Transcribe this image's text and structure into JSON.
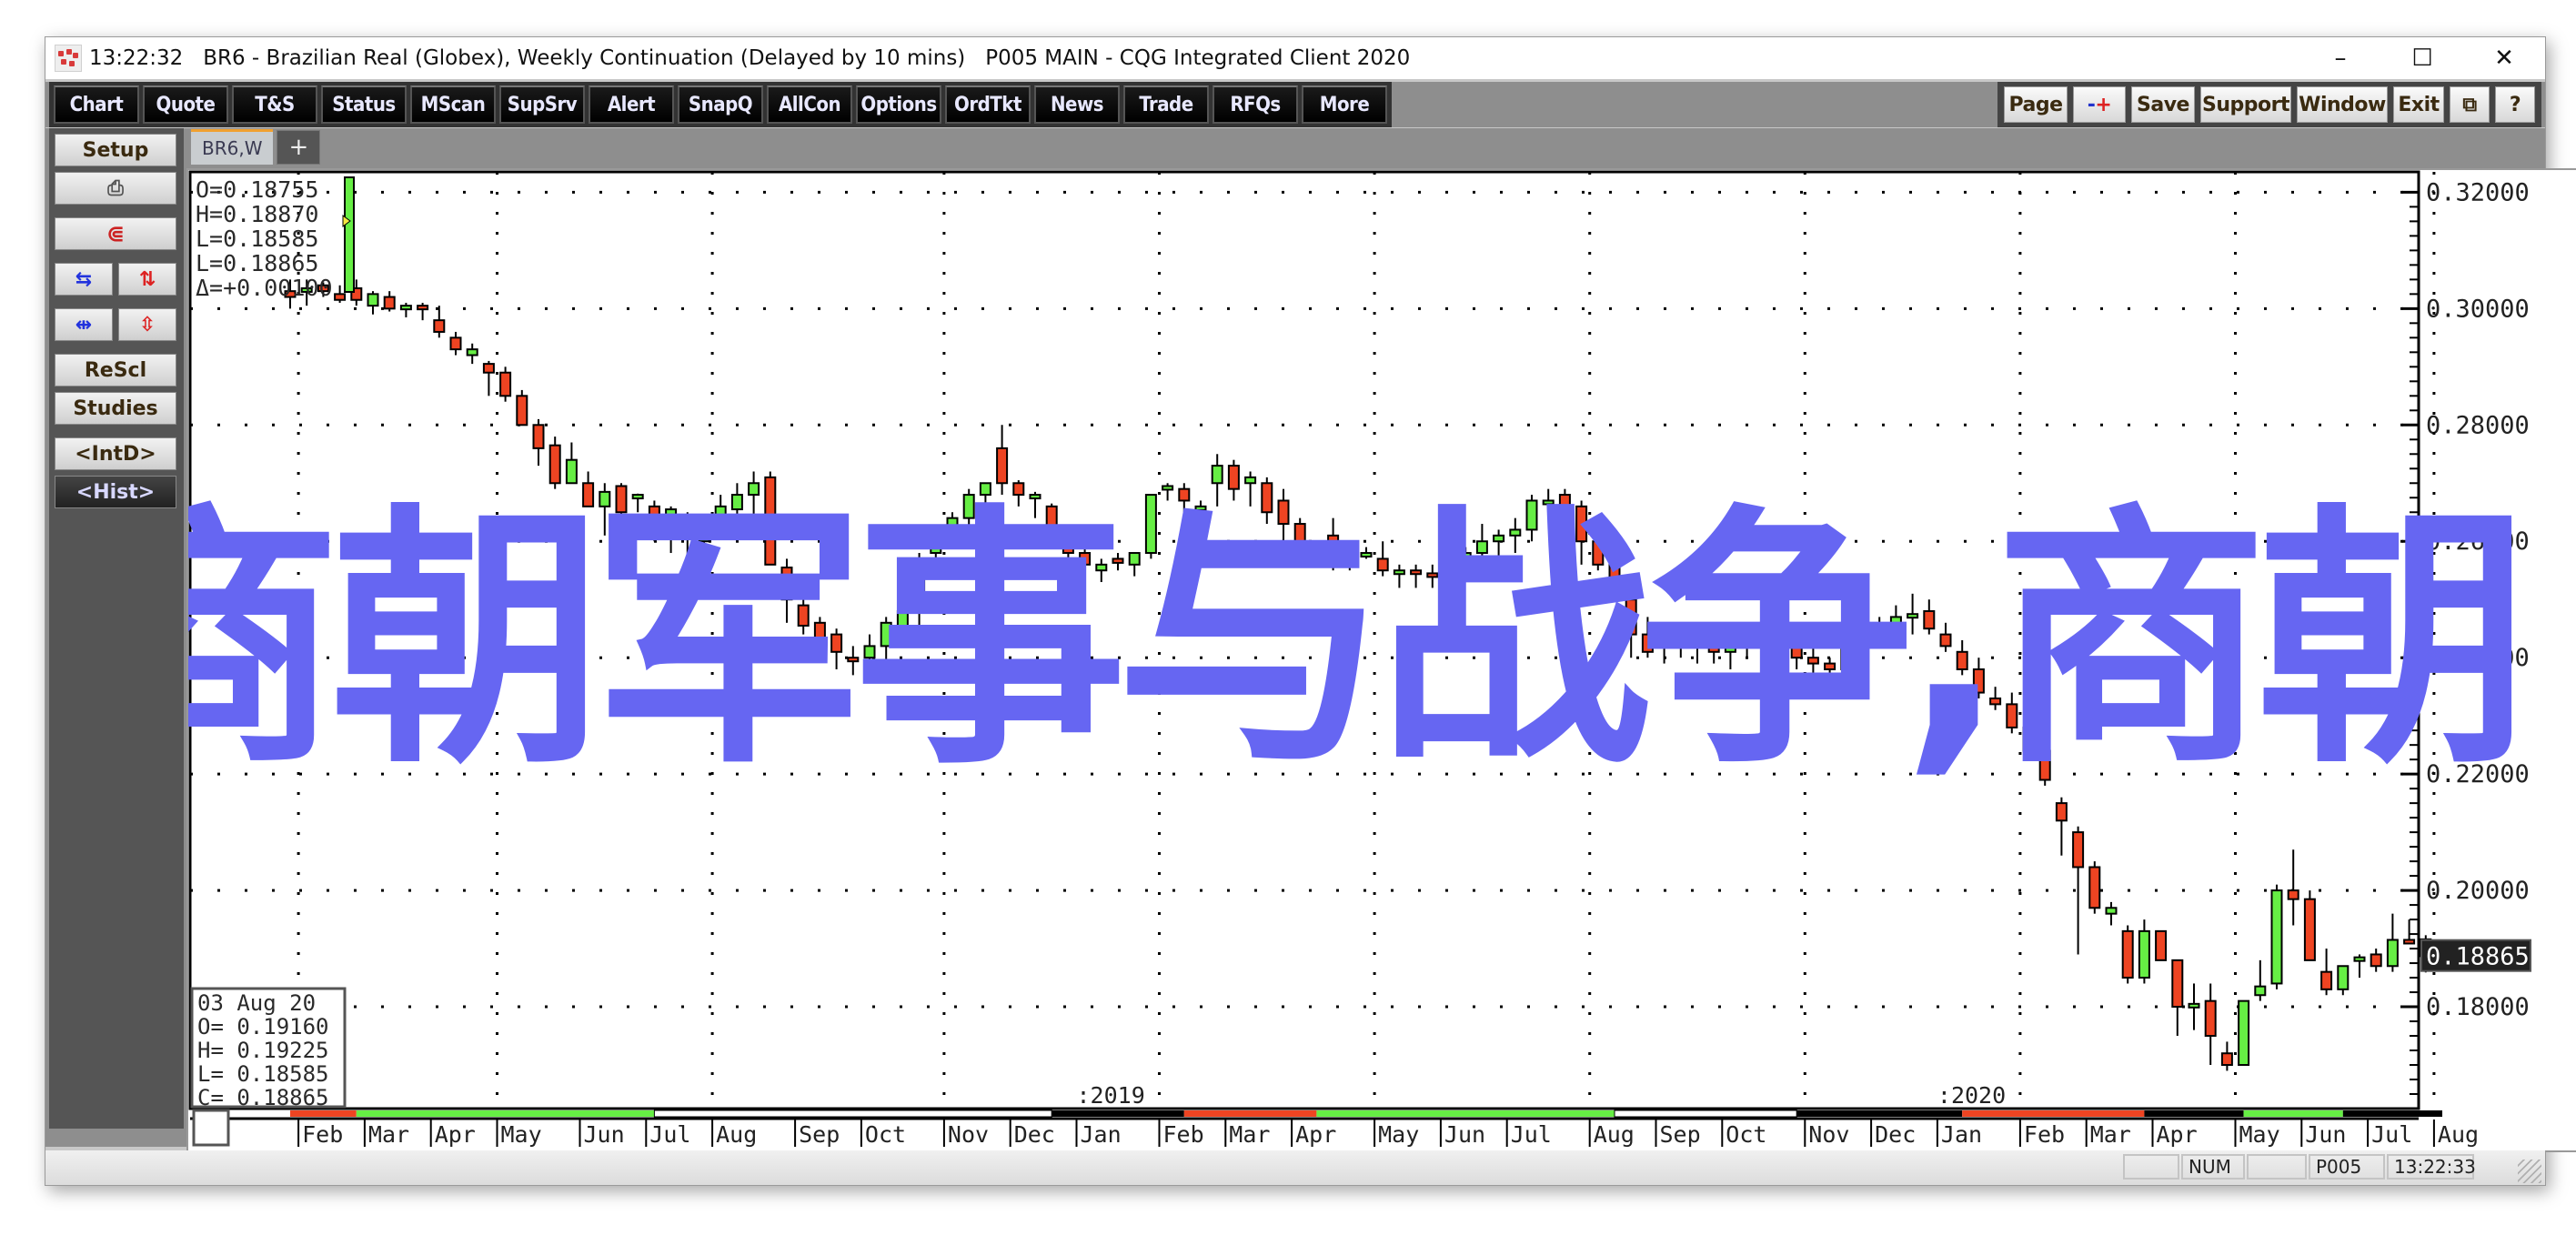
{
  "window": {
    "title": "13:22:32   BR6 - Brazilian Real (Globex), Weekly Continuation (Delayed by 10 mins)   P005 MAIN - CQG Integrated Client 2020",
    "controls": {
      "minimize": "–",
      "maximize": "☐",
      "close": "✕"
    }
  },
  "toolbar": {
    "left": [
      "Chart",
      "Quote",
      "T&S",
      "Status",
      "MScan",
      "SupSrv",
      "Alert",
      "SnapQ",
      "AllCon",
      "Options",
      "OrdTkt",
      "News",
      "Trade",
      "RFQs",
      "More"
    ],
    "right": [
      "Page",
      "-+",
      "Save",
      "Support",
      "Window",
      "Exit",
      "⧉",
      "?"
    ]
  },
  "sidebar": {
    "setup": "Setup",
    "print_icon": "🖶",
    "magnet_icon": "⊂",
    "rescale": "ReScl",
    "studies": "Studies",
    "intd": "<IntD>",
    "hist": "<Hist>"
  },
  "tabs": {
    "active": "BR6,W",
    "add": "+"
  },
  "cursor_box": {
    "lines": [
      "O=0.18755",
      "H=0.18870",
      "L=0.18585",
      "L=0.18865",
      "Δ=+0.00100"
    ]
  },
  "bar_info": {
    "lines": [
      "03 Aug 20",
      "O= 0.19160",
      "H= 0.19225",
      "L= 0.18585",
      "C= 0.18865"
    ]
  },
  "last_price": "0.18865",
  "watermark": {
    "text": "商朝军事与战争,商朝",
    "color": "#6666f2"
  },
  "status": {
    "num": "NUM",
    "page": "P005",
    "time": "13:22:33"
  },
  "colors": {
    "up": "#66ee44",
    "down": "#ee4422",
    "bg": "#ffffff",
    "axis": "#000000"
  },
  "chart_data": {
    "type": "candlestick",
    "title": "BR6 - Brazilian Real (Globex), Weekly Continuation",
    "ylabel": "",
    "ylim": [
      0.165,
      0.3235
    ],
    "yticks": [
      "0.32000",
      "0.30000",
      "0.28000",
      "0.26000",
      "0.24000",
      "0.22000",
      "0.20000",
      "0.18000"
    ],
    "ytick_values": [
      0.32,
      0.3,
      0.28,
      0.26,
      0.24,
      0.22,
      0.2,
      0.18
    ],
    "grid": true,
    "year_labels": [
      {
        "label": "2019",
        "week_index": 48
      },
      {
        "label": "2020",
        "week_index": 100
      }
    ],
    "month_labels": [
      {
        "label": "Feb",
        "week_index": 1
      },
      {
        "label": "Mar",
        "week_index": 5
      },
      {
        "label": "Apr",
        "week_index": 9
      },
      {
        "label": "May",
        "week_index": 13
      },
      {
        "label": "Jun",
        "week_index": 18
      },
      {
        "label": "Jul",
        "week_index": 22
      },
      {
        "label": "Aug",
        "week_index": 26
      },
      {
        "label": "Sep",
        "week_index": 31
      },
      {
        "label": "Oct",
        "week_index": 35
      },
      {
        "label": "Nov",
        "week_index": 40
      },
      {
        "label": "Dec",
        "week_index": 44
      },
      {
        "label": "Jan",
        "week_index": 48
      },
      {
        "label": "Feb",
        "week_index": 53
      },
      {
        "label": "Mar",
        "week_index": 57
      },
      {
        "label": "Apr",
        "week_index": 61
      },
      {
        "label": "May",
        "week_index": 66
      },
      {
        "label": "Jun",
        "week_index": 70
      },
      {
        "label": "Jul",
        "week_index": 74
      },
      {
        "label": "Aug",
        "week_index": 79
      },
      {
        "label": "Sep",
        "week_index": 83
      },
      {
        "label": "Oct",
        "week_index": 87
      },
      {
        "label": "Nov",
        "week_index": 92
      },
      {
        "label": "Dec",
        "week_index": 96
      },
      {
        "label": "Jan",
        "week_index": 100
      },
      {
        "label": "Feb",
        "week_index": 105
      },
      {
        "label": "Mar",
        "week_index": 109
      },
      {
        "label": "Apr",
        "week_index": 113
      },
      {
        "label": "May",
        "week_index": 118
      },
      {
        "label": "Jun",
        "week_index": 122
      },
      {
        "label": "Jul",
        "week_index": 126
      },
      {
        "label": "Aug",
        "week_index": 130
      }
    ],
    "ohlc": [
      [
        0.303,
        0.305,
        0.3,
        0.302
      ],
      [
        0.303,
        0.305,
        0.3005,
        0.3035
      ],
      [
        0.304,
        0.3045,
        0.302,
        0.303
      ],
      [
        0.3025,
        0.304,
        0.301,
        0.3015
      ],
      [
        0.3035,
        0.305,
        0.3005,
        0.3015
      ],
      [
        0.3005,
        0.303,
        0.299,
        0.3025
      ],
      [
        0.302,
        0.303,
        0.2995,
        0.3
      ],
      [
        0.3,
        0.301,
        0.2985,
        0.3005
      ],
      [
        0.3005,
        0.301,
        0.298,
        0.3003
      ],
      [
        0.298,
        0.3005,
        0.295,
        0.296
      ],
      [
        0.295,
        0.296,
        0.292,
        0.293
      ],
      [
        0.292,
        0.294,
        0.2905,
        0.293
      ],
      [
        0.2905,
        0.291,
        0.285,
        0.289
      ],
      [
        0.289,
        0.29,
        0.284,
        0.285
      ],
      [
        0.285,
        0.286,
        0.28,
        0.28
      ],
      [
        0.28,
        0.281,
        0.273,
        0.276
      ],
      [
        0.2765,
        0.278,
        0.269,
        0.27
      ],
      [
        0.27,
        0.277,
        0.27,
        0.274
      ],
      [
        0.27,
        0.272,
        0.266,
        0.266
      ],
      [
        0.266,
        0.27,
        0.261,
        0.2685
      ],
      [
        0.2695,
        0.27,
        0.263,
        0.265
      ],
      [
        0.268,
        0.2682,
        0.265,
        0.268
      ],
      [
        0.266,
        0.267,
        0.26,
        0.263
      ],
      [
        0.263,
        0.266,
        0.258,
        0.2655
      ],
      [
        0.264,
        0.265,
        0.257,
        0.262
      ],
      [
        0.26,
        0.264,
        0.259,
        0.262
      ],
      [
        0.262,
        0.268,
        0.261,
        0.266
      ],
      [
        0.2655,
        0.27,
        0.262,
        0.268
      ],
      [
        0.268,
        0.272,
        0.264,
        0.27
      ],
      [
        0.271,
        0.272,
        0.256,
        0.256
      ],
      [
        0.2555,
        0.257,
        0.246,
        0.25
      ],
      [
        0.249,
        0.251,
        0.244,
        0.2455
      ],
      [
        0.246,
        0.247,
        0.241,
        0.243
      ],
      [
        0.244,
        0.245,
        0.238,
        0.241
      ],
      [
        0.24,
        0.242,
        0.237,
        0.2395
      ],
      [
        0.24,
        0.244,
        0.238,
        0.242
      ],
      [
        0.242,
        0.247,
        0.239,
        0.246
      ],
      [
        0.245,
        0.25,
        0.243,
        0.248
      ],
      [
        0.248,
        0.258,
        0.245,
        0.257
      ],
      [
        0.258,
        0.26,
        0.254,
        0.26
      ],
      [
        0.262,
        0.265,
        0.26,
        0.264
      ],
      [
        0.264,
        0.269,
        0.261,
        0.268
      ],
      [
        0.268,
        0.27,
        0.265,
        0.27
      ],
      [
        0.276,
        0.28,
        0.268,
        0.27
      ],
      [
        0.27,
        0.2705,
        0.266,
        0.268
      ],
      [
        0.268,
        0.2685,
        0.264,
        0.268
      ],
      [
        0.266,
        0.2665,
        0.26,
        0.26
      ],
      [
        0.26,
        0.262,
        0.256,
        0.258
      ],
      [
        0.258,
        0.26,
        0.256,
        0.256
      ],
      [
        0.255,
        0.257,
        0.253,
        0.256
      ],
      [
        0.257,
        0.258,
        0.255,
        0.2563
      ],
      [
        0.256,
        0.258,
        0.254,
        0.258
      ],
      [
        0.258,
        0.268,
        0.257,
        0.268
      ],
      [
        0.269,
        0.27,
        0.267,
        0.2695
      ],
      [
        0.269,
        0.27,
        0.265,
        0.267
      ],
      [
        0.266,
        0.267,
        0.264,
        0.266
      ],
      [
        0.27,
        0.275,
        0.266,
        0.273
      ],
      [
        0.273,
        0.274,
        0.267,
        0.269
      ],
      [
        0.27,
        0.272,
        0.266,
        0.271
      ],
      [
        0.27,
        0.271,
        0.263,
        0.265
      ],
      [
        0.267,
        0.269,
        0.26,
        0.263
      ],
      [
        0.263,
        0.264,
        0.257,
        0.258
      ],
      [
        0.258,
        0.26,
        0.256,
        0.259
      ],
      [
        0.261,
        0.264,
        0.255,
        0.258
      ],
      [
        0.258,
        0.259,
        0.255,
        0.258
      ],
      [
        0.2575,
        0.259,
        0.257,
        0.258
      ],
      [
        0.257,
        0.26,
        0.254,
        0.255
      ],
      [
        0.255,
        0.256,
        0.252,
        0.255
      ],
      [
        0.255,
        0.256,
        0.252,
        0.2545
      ],
      [
        0.2545,
        0.256,
        0.252,
        0.254
      ],
      [
        0.25,
        0.256,
        0.245,
        0.255
      ],
      [
        0.255,
        0.259,
        0.253,
        0.258
      ],
      [
        0.258,
        0.263,
        0.255,
        0.26
      ],
      [
        0.26,
        0.262,
        0.256,
        0.261
      ],
      [
        0.261,
        0.264,
        0.258,
        0.262
      ],
      [
        0.262,
        0.268,
        0.26,
        0.267
      ],
      [
        0.267,
        0.269,
        0.265,
        0.267
      ],
      [
        0.268,
        0.269,
        0.263,
        0.266
      ],
      [
        0.266,
        0.267,
        0.256,
        0.26
      ],
      [
        0.26,
        0.262,
        0.255,
        0.256
      ],
      [
        0.256,
        0.258,
        0.25,
        0.252
      ],
      [
        0.25,
        0.252,
        0.24,
        0.244
      ],
      [
        0.244,
        0.247,
        0.24,
        0.241
      ],
      [
        0.242,
        0.244,
        0.239,
        0.243
      ],
      [
        0.243,
        0.245,
        0.24,
        0.244
      ],
      [
        0.2435,
        0.244,
        0.239,
        0.2432
      ],
      [
        0.244,
        0.245,
        0.239,
        0.241
      ],
      [
        0.241,
        0.244,
        0.238,
        0.242
      ],
      [
        0.242,
        0.246,
        0.24,
        0.245
      ],
      [
        0.245,
        0.247,
        0.242,
        0.245
      ],
      [
        0.244,
        0.246,
        0.24,
        0.242
      ],
      [
        0.242,
        0.244,
        0.238,
        0.24
      ],
      [
        0.24,
        0.242,
        0.237,
        0.239
      ],
      [
        0.239,
        0.24,
        0.236,
        0.238
      ],
      [
        0.238,
        0.243,
        0.236,
        0.242
      ],
      [
        0.242,
        0.245,
        0.24,
        0.244
      ],
      [
        0.244,
        0.247,
        0.242,
        0.245
      ],
      [
        0.245,
        0.249,
        0.244,
        0.247
      ],
      [
        0.247,
        0.251,
        0.244,
        0.2475
      ],
      [
        0.248,
        0.25,
        0.244,
        0.245
      ],
      [
        0.244,
        0.246,
        0.241,
        0.242
      ],
      [
        0.241,
        0.243,
        0.237,
        0.238
      ],
      [
        0.238,
        0.24,
        0.233,
        0.234
      ],
      [
        0.233,
        0.235,
        0.231,
        0.232
      ],
      [
        0.232,
        0.234,
        0.227,
        0.228
      ],
      [
        0.228,
        0.23,
        0.223,
        0.224
      ],
      [
        0.224,
        0.225,
        0.218,
        0.219
      ],
      [
        0.215,
        0.216,
        0.206,
        0.212
      ],
      [
        0.21,
        0.211,
        0.189,
        0.204
      ],
      [
        0.204,
        0.205,
        0.196,
        0.197
      ],
      [
        0.196,
        0.198,
        0.194,
        0.197
      ],
      [
        0.193,
        0.194,
        0.184,
        0.185
      ],
      [
        0.185,
        0.195,
        0.184,
        0.193
      ],
      [
        0.193,
        0.193,
        0.188,
        0.188
      ],
      [
        0.188,
        0.188,
        0.175,
        0.18
      ],
      [
        0.18,
        0.184,
        0.176,
        0.1805
      ],
      [
        0.181,
        0.184,
        0.17,
        0.175
      ],
      [
        0.172,
        0.174,
        0.169,
        0.17
      ],
      [
        0.17,
        0.181,
        0.17,
        0.181
      ],
      [
        0.182,
        0.188,
        0.181,
        0.1835
      ],
      [
        0.184,
        0.201,
        0.183,
        0.2
      ],
      [
        0.2,
        0.207,
        0.194,
        0.1985
      ],
      [
        0.1985,
        0.2,
        0.19,
        0.188
      ],
      [
        0.186,
        0.19,
        0.182,
        0.183
      ],
      [
        0.183,
        0.187,
        0.182,
        0.187
      ],
      [
        0.188,
        0.189,
        0.185,
        0.1885
      ],
      [
        0.189,
        0.19,
        0.186,
        0.187
      ],
      [
        0.187,
        0.196,
        0.186,
        0.1915
      ],
      [
        0.1915,
        0.195,
        0.191,
        0.191
      ],
      [
        0.1916,
        0.1923,
        0.1859,
        0.1887
      ]
    ]
  }
}
